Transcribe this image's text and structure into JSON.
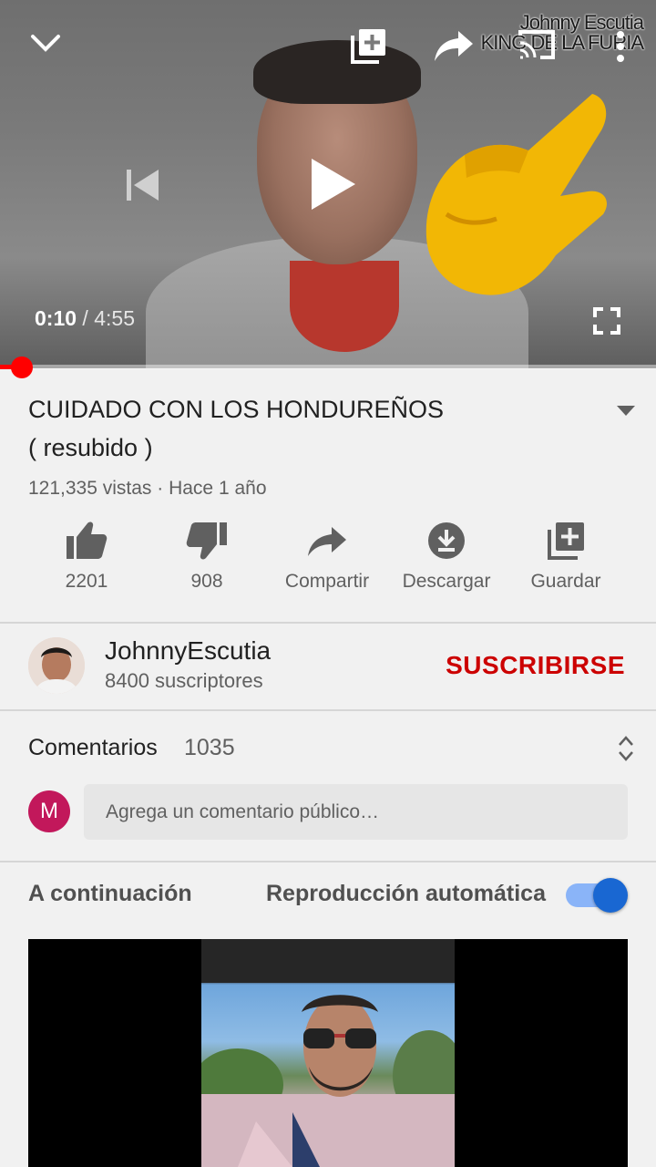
{
  "player": {
    "watermark_line1": "Johnny Escutia",
    "watermark_line2": "KING DE LA FURIA",
    "current_time": "0:10",
    "separator": " / ",
    "duration": "4:55",
    "progress_fraction": 0.034,
    "icons": [
      "chevron-down-icon",
      "add-to-queue-icon",
      "share-icon",
      "cast-icon",
      "more-vert-icon",
      "skip-previous-icon",
      "play-icon",
      "fullscreen-icon"
    ]
  },
  "video": {
    "title_line1": "CUIDADO CON LOS HONDUREÑOS",
    "title_line2": "( resubido )",
    "meta": "121,335 vistas · Hace 1 año"
  },
  "actions": [
    {
      "label": "2201",
      "icon": "thumb-up-icon"
    },
    {
      "label": "908",
      "icon": "thumb-down-icon"
    },
    {
      "label": "Compartir",
      "icon": "share-icon"
    },
    {
      "label": "Descargar",
      "icon": "download-icon"
    },
    {
      "label": "Guardar",
      "icon": "playlist-add-icon"
    }
  ],
  "channel": {
    "name": "JohnnyEscutia",
    "subscribers": "8400 suscriptores",
    "subscribe_label": "SUSCRIBIRSE"
  },
  "comments": {
    "label": "Comentarios",
    "count": "1035",
    "user_initial": "M",
    "placeholder": "Agrega un comentario público…"
  },
  "up_next": {
    "label": "A continuación",
    "autoplay_label": "Reproducción automática",
    "autoplay_on": true
  },
  "colors": {
    "accent_red": "#cc0000",
    "progress_red": "#ff0000",
    "toggle_blue": "#1967d2",
    "user_avatar": "#c2185b"
  }
}
